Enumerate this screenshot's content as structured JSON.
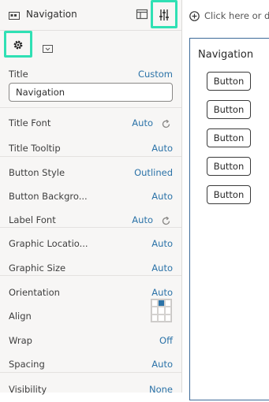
{
  "header": {
    "title": "Navigation"
  },
  "properties": {
    "title": {
      "label": "Title",
      "value": "Custom",
      "input_value": "Navigation"
    },
    "title_font": {
      "label": "Title Font",
      "value": "Auto"
    },
    "title_tooltip": {
      "label": "Title Tooltip",
      "value": "Auto"
    },
    "button_style": {
      "label": "Button Style",
      "value": "Outlined"
    },
    "button_background": {
      "label": "Button Backgro...",
      "value": "Auto"
    },
    "label_font": {
      "label": "Label Font",
      "value": "Auto"
    },
    "graphic_location": {
      "label": "Graphic Locatio...",
      "value": "Auto"
    },
    "graphic_size": {
      "label": "Graphic Size",
      "value": "Auto"
    },
    "orientation": {
      "label": "Orientation",
      "value": "Auto"
    },
    "align": {
      "label": "Align",
      "selected_cell": "top-center"
    },
    "wrap": {
      "label": "Wrap",
      "value": "Off"
    },
    "spacing": {
      "label": "Spacing",
      "value": "Auto"
    },
    "visibility": {
      "label": "Visibility",
      "value": "None"
    }
  },
  "canvas": {
    "hint": "Click here or dr",
    "title": "Navigation",
    "buttons": [
      "Button",
      "Button",
      "Button",
      "Button",
      "Button"
    ]
  },
  "colors": {
    "accent": "#2fe0b4",
    "link": "#2c73a8",
    "frame": "#3d6a98"
  }
}
